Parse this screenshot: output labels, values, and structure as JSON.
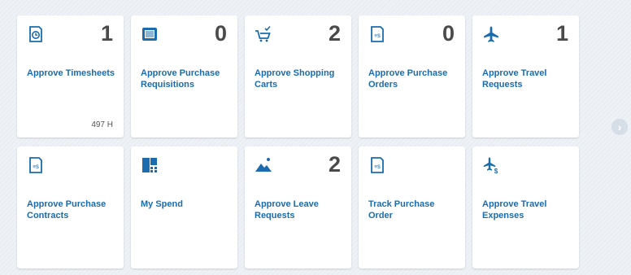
{
  "tiles": [
    {
      "id": "approve-timesheets",
      "title": "Approve Timesheets",
      "count": "1",
      "footer": "497 H",
      "icon": "clock-document-icon"
    },
    {
      "id": "approve-purchase-requisitions",
      "title": "Approve Purchase Requisitions",
      "count": "0",
      "footer": "",
      "icon": "requisition-icon"
    },
    {
      "id": "approve-shopping-carts",
      "title": "Approve Shopping Carts",
      "count": "2",
      "footer": "",
      "icon": "cart-check-icon"
    },
    {
      "id": "approve-purchase-orders",
      "title": "Approve Purchase Orders",
      "count": "0",
      "footer": "",
      "icon": "purchase-order-icon"
    },
    {
      "id": "approve-travel-requests",
      "title": "Approve Travel Requests",
      "count": "1",
      "footer": "",
      "icon": "airplane-icon"
    },
    {
      "id": "approve-purchase-contracts",
      "title": "Approve Purchase Contracts",
      "count": "",
      "footer": "",
      "icon": "contract-icon"
    },
    {
      "id": "my-spend",
      "title": "My Spend",
      "count": "",
      "footer": "",
      "icon": "spend-blocks-icon"
    },
    {
      "id": "approve-leave-requests",
      "title": "Approve Leave Requests",
      "count": "2",
      "footer": "",
      "icon": "mountain-sun-icon"
    },
    {
      "id": "track-purchase-order",
      "title": "Track Purchase Order",
      "count": "",
      "footer": "",
      "icon": "purchase-order-icon"
    },
    {
      "id": "approve-travel-expenses",
      "title": "Approve Travel Expenses",
      "count": "",
      "footer": "",
      "icon": "airplane-dollar-icon"
    }
  ],
  "nav": {
    "next_glyph": "›"
  },
  "colors": {
    "accent": "#1a6cae",
    "count": "#4a4a4a"
  }
}
